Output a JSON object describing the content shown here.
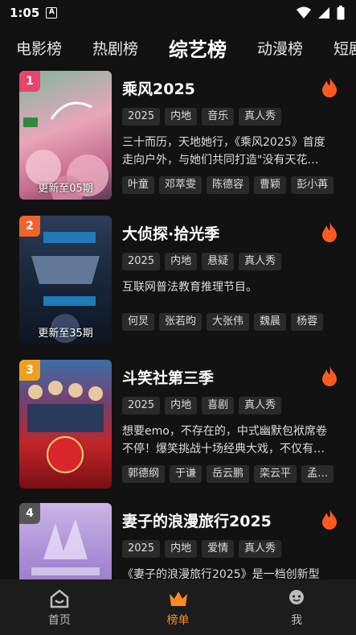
{
  "status": {
    "time": "1:05",
    "app_icon": "A"
  },
  "tabs": [
    {
      "label": "电影榜",
      "active": false
    },
    {
      "label": "热剧榜",
      "active": false
    },
    {
      "label": "综艺榜",
      "active": true
    },
    {
      "label": "动漫榜",
      "active": false
    },
    {
      "label": "短剧",
      "active": false
    }
  ],
  "items": [
    {
      "rank": "1",
      "rank_color": "#e8456a",
      "title": "乘风2025",
      "update": "更新至05期",
      "tags": [
        "2025",
        "内地",
        "音乐",
        "真人秀"
      ],
      "desc": "三十而历，天地她行，《乘风2025》首度走向户外，与她们共同打造\"没有天花…",
      "cast": [
        "叶童",
        "邓萃雯",
        "陈德容",
        "曹颖",
        "彭小苒"
      ]
    },
    {
      "rank": "2",
      "rank_color": "#f0632a",
      "title": "大侦探·拾光季",
      "update": "更新至35期",
      "tags": [
        "2025",
        "内地",
        "悬疑",
        "真人秀"
      ],
      "desc": "互联网普法教育推理节目。",
      "cast": [
        "何炅",
        "张若昀",
        "大张伟",
        "魏晨",
        "杨蓉"
      ]
    },
    {
      "rank": "3",
      "rank_color": "#f0a020",
      "title": "斗笑社第三季",
      "update": "",
      "tags": [
        "2025",
        "内地",
        "喜剧",
        "真人秀"
      ],
      "desc": "想要emo，不存在的，中式幽默包袱席卷不停！爆笑挑战十场经典大戏，不仅有…",
      "cast": [
        "郭德纲",
        "于谦",
        "岳云鹏",
        "栾云平",
        "孟…"
      ]
    },
    {
      "rank": "4",
      "rank_color": "#555555",
      "title": "妻子的浪漫旅行2025",
      "update": "",
      "tags": [
        "2025",
        "内地",
        "爱情",
        "真人秀"
      ],
      "desc": "《妻子的浪漫旅行2025》是一档创新型",
      "cast": []
    }
  ],
  "bottom_nav": [
    {
      "label": "首页",
      "icon": "home-icon",
      "active": false
    },
    {
      "label": "榜单",
      "icon": "crown-icon",
      "active": true
    },
    {
      "label": "我",
      "icon": "profile-icon",
      "active": false
    }
  ],
  "colors": {
    "accent": "#ff8a1f",
    "fire": "#ff5a1f",
    "background": "#121212"
  }
}
